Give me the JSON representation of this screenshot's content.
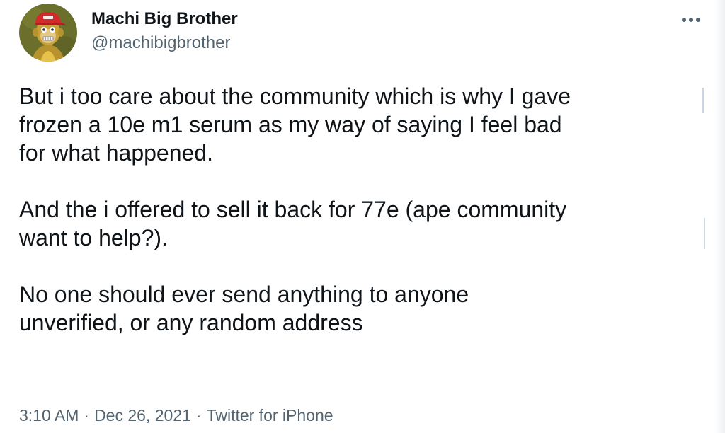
{
  "author": {
    "display_name": "Machi Big Brother",
    "handle": "@machibigbrother",
    "avatar_icon": "ape-avatar-icon"
  },
  "menu": {
    "icon": "more-horizontal-icon"
  },
  "tweet": {
    "paragraphs": [
      {
        "lines": [
          "But i too care about the community which is why I gave",
          "frozen a 10e m1 serum as my way of saying I feel bad",
          "for what happened."
        ]
      },
      {
        "lines": [
          "And the i offered to sell it back for 77e (ape community",
          "want to help?)."
        ]
      },
      {
        "lines": [
          "No one should ever send anything to anyone",
          "unverified, or any random address"
        ]
      }
    ]
  },
  "meta": {
    "time": "3:10 AM",
    "separator": "·",
    "date": "Dec 26, 2021",
    "source": "Twitter for iPhone"
  },
  "colors": {
    "text_primary": "#0f1419",
    "text_secondary": "#536471",
    "background": "#ffffff",
    "avatar_background": "#6b6f2c",
    "avatar_cap": "#d42a2a",
    "avatar_fur": "#c9a23a"
  }
}
